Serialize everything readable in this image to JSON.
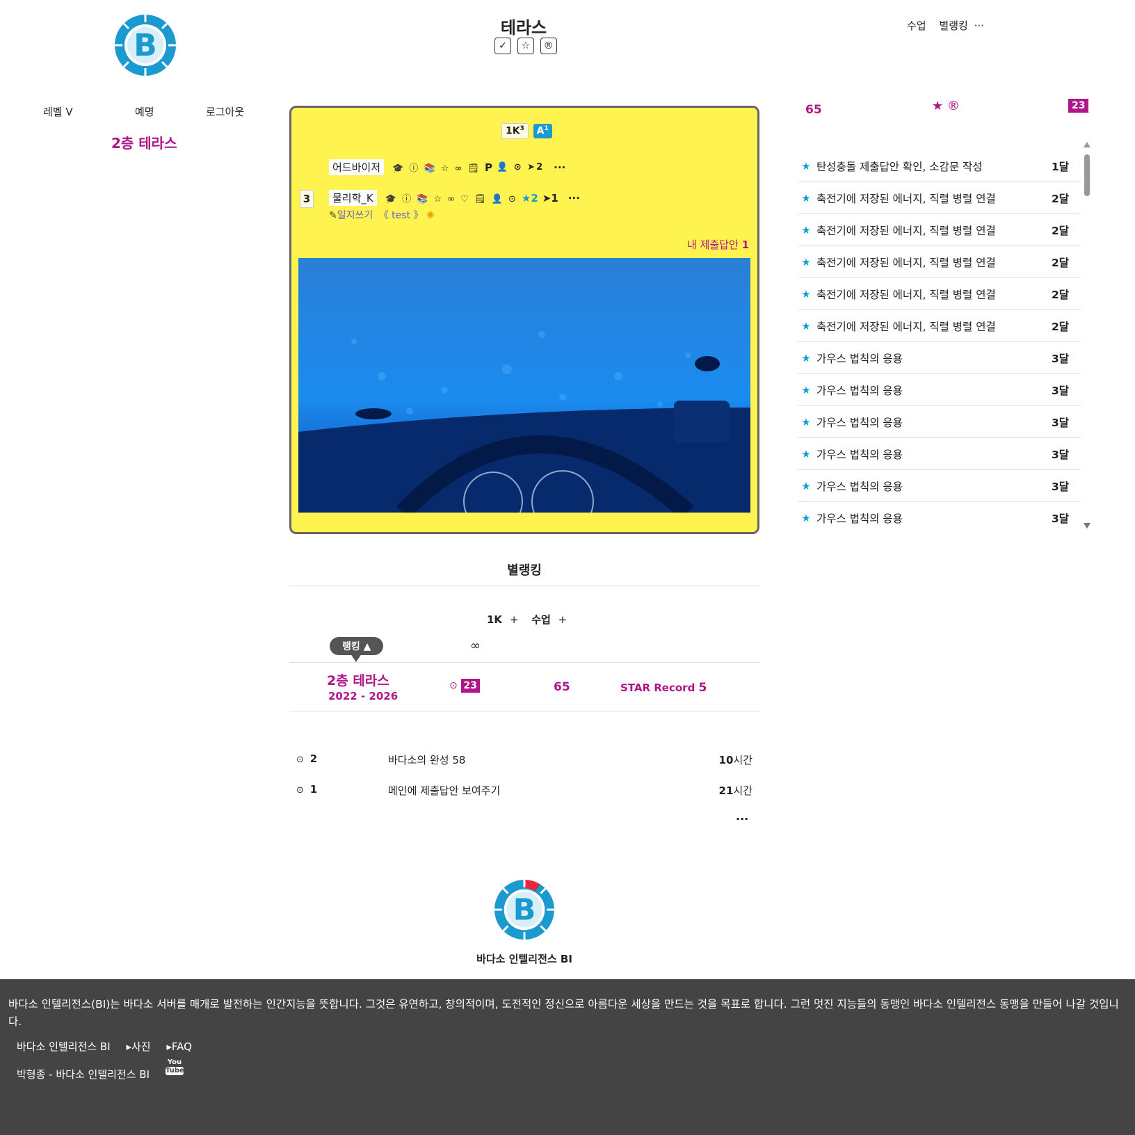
{
  "header": {
    "title": "테라스",
    "nav": [
      "수업",
      "별랭킹",
      "···"
    ],
    "title_icons": [
      "✓",
      "☆",
      "®"
    ]
  },
  "left": {
    "menu": [
      "레벨 V",
      "예명",
      "로그아웃"
    ],
    "floor_title": "2층 테라스"
  },
  "card": {
    "badge1": "1K",
    "badge1_sup": "3",
    "badge2": "A",
    "badge2_sup": "1",
    "row1_name": "어드바이저",
    "row1_icons": "🎓 ⓘ 📚 ☆ ∞ 🗒",
    "row1_p": "P",
    "row1_tail": "👤 ⊙ ➤2",
    "row2_num": "3",
    "row2_name": "물리학_K",
    "row2_icons": "🎓 ⓘ 📚 ☆ ∞ ♡ 🗒 👤 ⊙",
    "row2_star": "★2",
    "row2_tail": "➤1",
    "more": "···",
    "diary_label": "일지쓰기",
    "diary_text": "《 test 》",
    "my_submissions_label": "내 제출답안",
    "my_submissions_count": "1"
  },
  "right": {
    "score": "65",
    "count_badge": "23",
    "list": [
      {
        "title": "탄성충돌 제출답안 확인, 소감문 작성",
        "when": "1달"
      },
      {
        "title": "축전기에 저장된 에너지, 직렬 병렬 연결",
        "when": "2달"
      },
      {
        "title": "축전기에 저장된 에너지, 직렬 병렬 연결",
        "when": "2달"
      },
      {
        "title": "축전기에 저장된 에너지, 직렬 병렬 연결",
        "when": "2달"
      },
      {
        "title": "축전기에 저장된 에너지, 직렬 병렬 연결",
        "when": "2달"
      },
      {
        "title": "축전기에 저장된 에너지, 직렬 병렬 연결",
        "when": "2달"
      },
      {
        "title": "가우스 법칙의 응용",
        "when": "3달"
      },
      {
        "title": "가우스 법칙의 응용",
        "when": "3달"
      },
      {
        "title": "가우스 법칙의 응용",
        "when": "3달"
      },
      {
        "title": "가우스 법칙의 응용",
        "when": "3달"
      },
      {
        "title": "가우스 법칙의 응용",
        "when": "3달"
      },
      {
        "title": "가우스 법칙의 응용",
        "when": "3달"
      }
    ]
  },
  "ranking": {
    "title": "별랭킹",
    "filter1": "1K",
    "filter2": "수업",
    "plus": "+",
    "sort_pill": "랭킹 ▲",
    "infinity": "∞",
    "row_name": "2층 테라스",
    "row_years": "2022 - 2026",
    "row_badge": "23",
    "row_score": "65",
    "row_record_label": "STAR Record",
    "row_record_value": "5"
  },
  "activity": [
    {
      "num": "2",
      "title": "바다소의 완성 58",
      "time_num": "10",
      "time_unit": "시간"
    },
    {
      "num": "1",
      "title": "메인에 제출답안 보여주기",
      "time_num": "21",
      "time_unit": "시간"
    }
  ],
  "activity_more": "···",
  "brand": "바다소 인텔리전스 BI",
  "footer": {
    "description": "바다소 인텔리전스(BI)는 바다소 서버를 매개로 발전하는 인간지능을 뜻합니다. 그것은 유연하고, 창의적이며, 도전적인 정신으로 아름다운 세상을 만드는 것을 목표로 합니다. 그런 멋진 지능들의 동맹인 바다소 인텔리전스 동맹을 만들어 나갈 것입니다.",
    "link1": "바다소 인텔리전스 BI",
    "link2": "사진",
    "link3": "FAQ",
    "author": "박형종 - 바다소 인텔리전스 BI",
    "youtube_top": "You",
    "youtube_bottom": "Tube"
  },
  "colors": {
    "accent": "#b0168a",
    "blue": "#1b9ad0",
    "card_bg": "#fff44f",
    "footer_bg": "#444444"
  }
}
